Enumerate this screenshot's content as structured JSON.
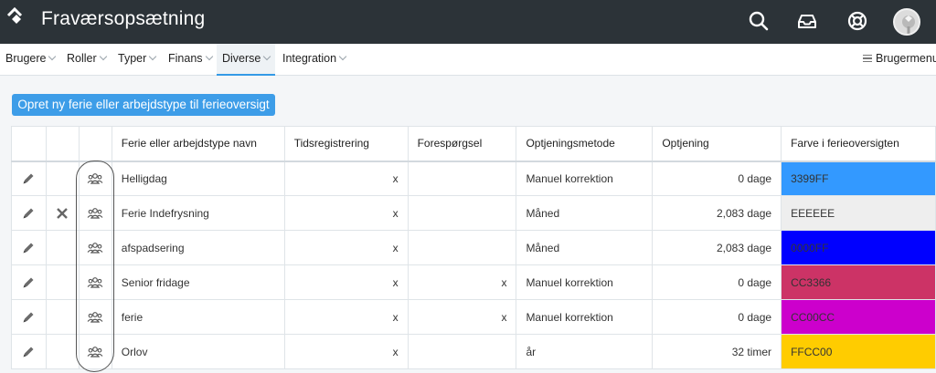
{
  "header": {
    "title": "Fraværsopsætning",
    "icons": [
      "logo-icon",
      "search-icon",
      "inbox-icon",
      "help-icon",
      "avatar"
    ]
  },
  "nav": {
    "items": [
      {
        "label": "Brugere"
      },
      {
        "label": "Roller"
      },
      {
        "label": "Typer"
      },
      {
        "label": "Finans"
      },
      {
        "label": "Diverse"
      },
      {
        "label": "Integration"
      }
    ],
    "active": "Diverse",
    "user_menu_label": "Brugermenu"
  },
  "main": {
    "create_button_label": "Opret ny ferie eller arbejdstype til ferieoversigt"
  },
  "table": {
    "columns": [
      "Ferie eller arbejdstype navn",
      "Tidsregistrering",
      "Forespørgsel",
      "Optjeningsmetode",
      "Optjening",
      "Farve i ferieoversigten"
    ],
    "rows": [
      {
        "name": "Helligdag",
        "tids": "x",
        "foresp": "",
        "metode": "Manuel korrektion",
        "optjening": "0 dage",
        "farve": "3399FF",
        "color": "#3399ff",
        "deletable": false
      },
      {
        "name": "Ferie Indefrysning",
        "tids": "x",
        "foresp": "",
        "metode": "Måned",
        "optjening": "2,083 dage",
        "farve": "EEEEEE",
        "color": "#eeeeee",
        "deletable": true
      },
      {
        "name": "afspadsering",
        "tids": "x",
        "foresp": "",
        "metode": "Måned",
        "optjening": "2,083 dage",
        "farve": "0000FF",
        "color": "#0000ff",
        "deletable": false
      },
      {
        "name": "Senior fridage",
        "tids": "x",
        "foresp": "x",
        "metode": "Manuel korrektion",
        "optjening": "0 dage",
        "farve": "CC3366",
        "color": "#cc3366",
        "deletable": false
      },
      {
        "name": "ferie",
        "tids": "x",
        "foresp": "x",
        "metode": "Manuel korrektion",
        "optjening": "0 dage",
        "farve": "CC00CC",
        "color": "#cc00cc",
        "deletable": false
      },
      {
        "name": "Orlov",
        "tids": "x",
        "foresp": "",
        "metode": "år",
        "optjening": "32 timer",
        "farve": "FFCC00",
        "color": "#ffcc00",
        "deletable": false
      }
    ]
  },
  "colors": {
    "topbar": "#2c3338",
    "accent": "#3d9de8"
  }
}
